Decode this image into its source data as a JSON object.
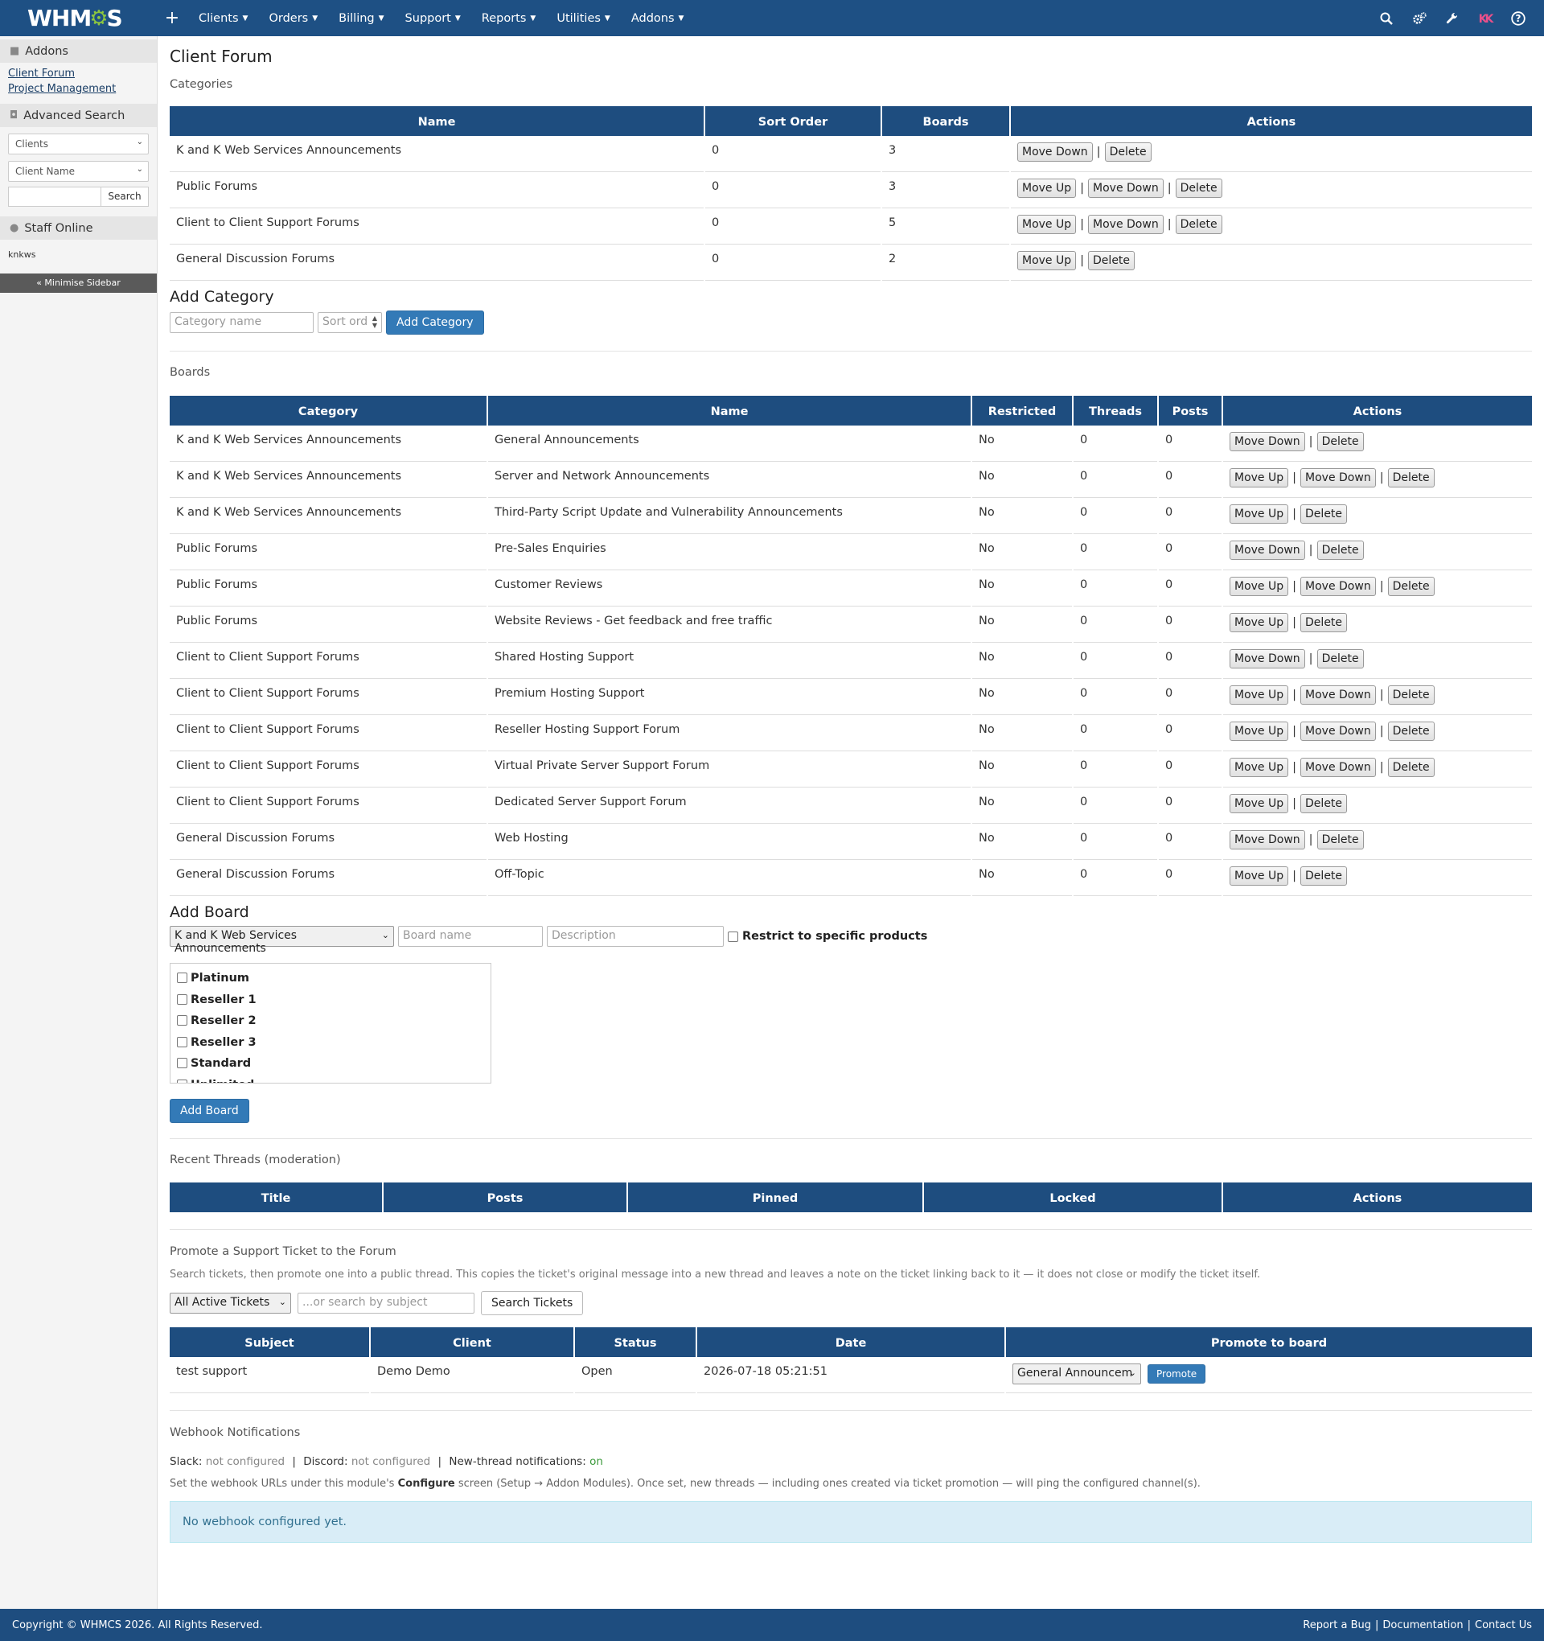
{
  "brand": {
    "logo_text_left": "WHM",
    "logo_text_right": "S"
  },
  "topnav": {
    "plus": "+",
    "menu": [
      "Clients",
      "Orders",
      "Billing",
      "Support",
      "Reports",
      "Utilities",
      "Addons"
    ],
    "icons": [
      "search-icon",
      "cogs-icon",
      "wrench-icon",
      "user-avatar-icon",
      "help-icon"
    ],
    "avatar_initials": "KK"
  },
  "sidebar": {
    "addons_title": "Addons",
    "links": [
      "Client Forum",
      "Project Management"
    ],
    "advanced_search_title": "Advanced Search",
    "search_type": "Clients",
    "search_field": "Client Name",
    "search_button": "Search",
    "staff_online_title": "Staff Online",
    "staff_name": "knkws",
    "minimise": "« Minimise Sidebar"
  },
  "page": {
    "title": "Client Forum",
    "categories_label": "Categories",
    "boards_label": "Boards",
    "add_category_title": "Add Category",
    "add_board_title": "Add Board",
    "recent_threads_label": "Recent Threads (moderation)",
    "promote_label": "Promote a Support Ticket to the Forum",
    "webhook_label": "Webhook Notifications"
  },
  "categories": {
    "headers": [
      "Name",
      "Sort Order",
      "Boards",
      "Actions"
    ],
    "rows": [
      {
        "name": "K and K Web Services Announcements",
        "sort": "0",
        "boards": "3",
        "actions": [
          "Move Down",
          "Delete"
        ]
      },
      {
        "name": "Public Forums",
        "sort": "0",
        "boards": "3",
        "actions": [
          "Move Up",
          "Move Down",
          "Delete"
        ]
      },
      {
        "name": "Client to Client Support Forums",
        "sort": "0",
        "boards": "5",
        "actions": [
          "Move Up",
          "Move Down",
          "Delete"
        ]
      },
      {
        "name": "General Discussion Forums",
        "sort": "0",
        "boards": "2",
        "actions": [
          "Move Up",
          "Delete"
        ]
      }
    ]
  },
  "add_category": {
    "name_placeholder": "Category name",
    "sort_placeholder": "Sort ord",
    "button": "Add Category"
  },
  "boards": {
    "headers": [
      "Category",
      "Name",
      "Restricted",
      "Threads",
      "Posts",
      "Actions"
    ],
    "rows": [
      {
        "category": "K and K Web Services Announcements",
        "name": "General Announcements",
        "restricted": "No",
        "threads": "0",
        "posts": "0",
        "actions": [
          "Move Down",
          "Delete"
        ]
      },
      {
        "category": "K and K Web Services Announcements",
        "name": "Server and Network Announcements",
        "restricted": "No",
        "threads": "0",
        "posts": "0",
        "actions": [
          "Move Up",
          "Move Down",
          "Delete"
        ]
      },
      {
        "category": "K and K Web Services Announcements",
        "name": "Third-Party Script Update and Vulnerability Announcements",
        "restricted": "No",
        "threads": "0",
        "posts": "0",
        "actions": [
          "Move Up",
          "Delete"
        ]
      },
      {
        "category": "Public Forums",
        "name": "Pre-Sales Enquiries",
        "restricted": "No",
        "threads": "0",
        "posts": "0",
        "actions": [
          "Move Down",
          "Delete"
        ]
      },
      {
        "category": "Public Forums",
        "name": "Customer Reviews",
        "restricted": "No",
        "threads": "0",
        "posts": "0",
        "actions": [
          "Move Up",
          "Move Down",
          "Delete"
        ]
      },
      {
        "category": "Public Forums",
        "name": "Website Reviews - Get feedback and free traffic",
        "restricted": "No",
        "threads": "0",
        "posts": "0",
        "actions": [
          "Move Up",
          "Delete"
        ]
      },
      {
        "category": "Client to Client Support Forums",
        "name": "Shared Hosting Support",
        "restricted": "No",
        "threads": "0",
        "posts": "0",
        "actions": [
          "Move Down",
          "Delete"
        ]
      },
      {
        "category": "Client to Client Support Forums",
        "name": "Premium Hosting Support",
        "restricted": "No",
        "threads": "0",
        "posts": "0",
        "actions": [
          "Move Up",
          "Move Down",
          "Delete"
        ]
      },
      {
        "category": "Client to Client Support Forums",
        "name": "Reseller Hosting Support Forum",
        "restricted": "No",
        "threads": "0",
        "posts": "0",
        "actions": [
          "Move Up",
          "Move Down",
          "Delete"
        ]
      },
      {
        "category": "Client to Client Support Forums",
        "name": "Virtual Private Server Support Forum",
        "restricted": "No",
        "threads": "0",
        "posts": "0",
        "actions": [
          "Move Up",
          "Move Down",
          "Delete"
        ]
      },
      {
        "category": "Client to Client Support Forums",
        "name": "Dedicated Server Support Forum",
        "restricted": "No",
        "threads": "0",
        "posts": "0",
        "actions": [
          "Move Up",
          "Delete"
        ]
      },
      {
        "category": "General Discussion Forums",
        "name": "Web Hosting",
        "restricted": "No",
        "threads": "0",
        "posts": "0",
        "actions": [
          "Move Down",
          "Delete"
        ]
      },
      {
        "category": "General Discussion Forums",
        "name": "Off-Topic",
        "restricted": "No",
        "threads": "0",
        "posts": "0",
        "actions": [
          "Move Up",
          "Delete"
        ]
      }
    ]
  },
  "add_board": {
    "category_selected": "K and K Web Services Announcements",
    "name_placeholder": "Board name",
    "description_placeholder": "Description",
    "restrict_label": "Restrict to specific products",
    "products": [
      "Platinum",
      "Reseller 1",
      "Reseller 2",
      "Reseller 3",
      "Standard",
      "Unlimited"
    ],
    "button": "Add Board"
  },
  "recent_threads": {
    "headers": [
      "Title",
      "Posts",
      "Pinned",
      "Locked",
      "Actions"
    ]
  },
  "promote": {
    "description": "Search tickets, then promote one into a public thread. This copies the ticket's original message into a new thread and leaves a note on the ticket linking back to it — it does not close or modify the ticket itself.",
    "filter_selected": "All Active Tickets",
    "subject_placeholder": "...or search by subject",
    "search_button": "Search Tickets",
    "headers": [
      "Subject",
      "Client",
      "Status",
      "Date",
      "Promote to board"
    ],
    "rows": [
      {
        "subject": "test support",
        "client": "Demo Demo",
        "status": "Open",
        "date": "2026-07-18 05:21:51",
        "board": "General Announcem",
        "button": "Promote"
      }
    ]
  },
  "webhook": {
    "slack_label": "Slack:",
    "slack_value": "not configured",
    "discord_label": "Discord:",
    "discord_value": "not configured",
    "newthread_label": "New-thread notifications:",
    "newthread_value": "on",
    "help_pre": "Set the webhook URLs under this module's ",
    "help_bold": "Configure",
    "help_post": " screen (Setup → Addon Modules). Once set, new threads — including ones created via ticket promotion — will ping the configured channel(s).",
    "alert": "No webhook configured yet."
  },
  "footer": {
    "copyright": "Copyright © WHMCS 2026. All Rights Reserved.",
    "links": [
      "Report a Bug",
      "Documentation",
      "Contact Us"
    ]
  },
  "colors": {
    "nav": "#1e5084",
    "header": "#1e4d7f",
    "accent": "#337ab7",
    "logo_gear": "#8cc63f"
  }
}
